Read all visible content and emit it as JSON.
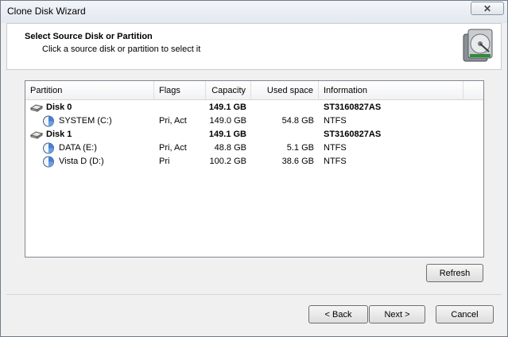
{
  "window": {
    "title": "Clone Disk Wizard",
    "close_glyph": "✕"
  },
  "header": {
    "title": "Select Source Disk or Partition",
    "subtitle": "Click a source disk or partition to select it",
    "logo_icon": "hard-disk-icon"
  },
  "table": {
    "columns": [
      "Partition",
      "Flags",
      "Capacity",
      "Used space",
      "Information"
    ],
    "rows": [
      {
        "type": "disk",
        "icon": "disk-drive-icon",
        "name": "Disk 0",
        "flags": "",
        "capacity": "149.1 GB",
        "used": "",
        "info": "ST3160827AS"
      },
      {
        "type": "partition",
        "icon": "partition-icon",
        "name": "SYSTEM (C:)",
        "flags": "Pri, Act",
        "capacity": "149.0 GB",
        "used": "54.8 GB",
        "info": "NTFS"
      },
      {
        "type": "disk",
        "icon": "disk-drive-icon",
        "name": "Disk 1",
        "flags": "",
        "capacity": "149.1 GB",
        "used": "",
        "info": "ST3160827AS"
      },
      {
        "type": "partition",
        "icon": "partition-icon",
        "name": "DATA (E:)",
        "flags": "Pri, Act",
        "capacity": "48.8 GB",
        "used": "5.1 GB",
        "info": "NTFS"
      },
      {
        "type": "partition",
        "icon": "partition-icon",
        "name": "Vista D (D:)",
        "flags": "Pri",
        "capacity": "100.2 GB",
        "used": "38.6 GB",
        "info": "NTFS"
      }
    ]
  },
  "buttons": {
    "refresh": "Refresh",
    "back": "< Back",
    "next": "Next >",
    "cancel": "Cancel"
  }
}
